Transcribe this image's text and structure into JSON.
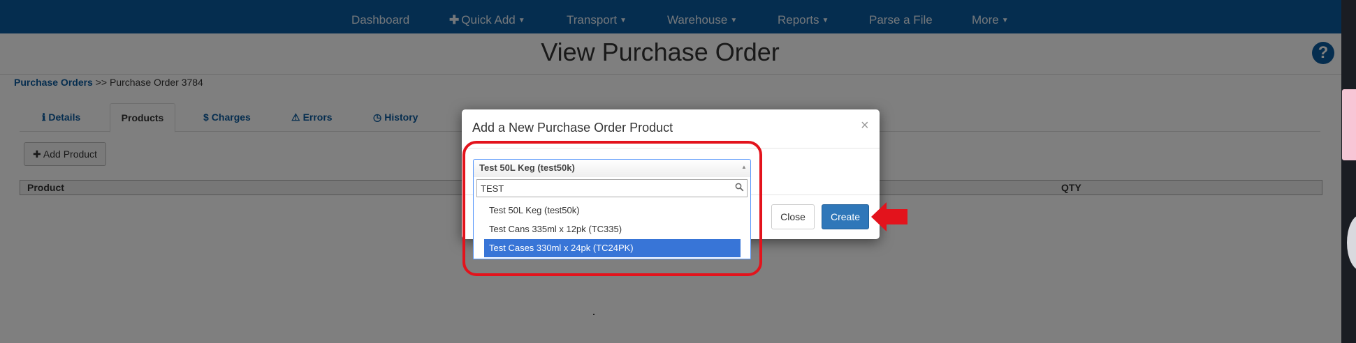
{
  "navbar": {
    "items": [
      {
        "label": "Dashboard"
      },
      {
        "label": "Quick Add"
      },
      {
        "label": "Transport"
      },
      {
        "label": "Warehouse"
      },
      {
        "label": "Reports"
      },
      {
        "label": "Parse a File"
      },
      {
        "label": "More"
      }
    ],
    "color": "#0a5a9e"
  },
  "page": {
    "title": "View Purchase Order",
    "help_glyph": "?"
  },
  "breadcrumb": {
    "link": "Purchase Orders",
    "separator": ">>",
    "current": "Purchase Order 3784"
  },
  "tabs": [
    {
      "label": "Details",
      "icon": "info-icon"
    },
    {
      "label": "Products",
      "icon": ""
    },
    {
      "label": "Charges",
      "icon": "dollar-icon"
    },
    {
      "label": "Errors",
      "icon": "warning-icon"
    },
    {
      "label": "History",
      "icon": "clock-icon"
    }
  ],
  "toolbar": {
    "add_product_label": "Add Product"
  },
  "grid": {
    "columns": [
      "Product",
      "QTY"
    ]
  },
  "modal": {
    "title": "Add a New Purchase Order Product",
    "close_glyph": "×",
    "select": {
      "selected": "Test 50L Keg (test50k)",
      "search_value": "TEST",
      "results": [
        {
          "label": "Test 50L Keg (test50k)",
          "highlighted": false
        },
        {
          "label": "Test Cans 335ml x 12pk (TC335)",
          "highlighted": false
        },
        {
          "label": "Test Cases 330ml x 24pk (TC24PK)",
          "highlighted": true
        }
      ]
    },
    "close_label": "Close",
    "create_label": "Create",
    "primary_color": "#2f77b9"
  },
  "annotation_color": "#e3131c"
}
